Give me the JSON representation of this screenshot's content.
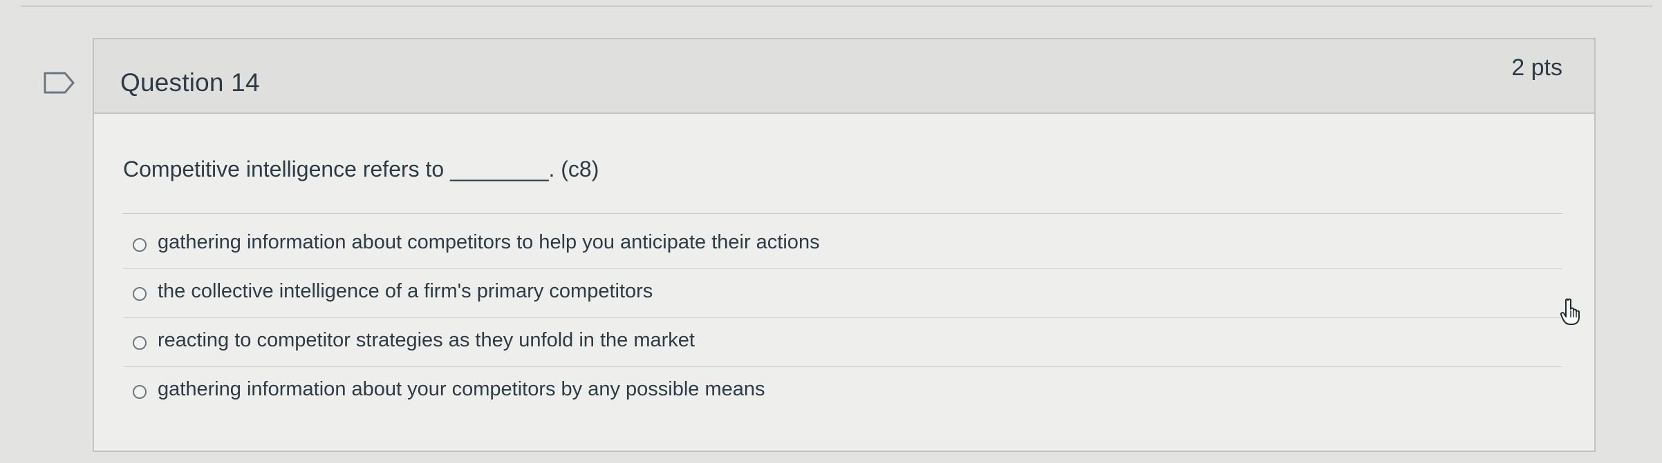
{
  "question": {
    "title": "Question 14",
    "points": "2 pts",
    "text": "Competitive intelligence refers to ________. (c8)",
    "answers": [
      {
        "label": "gathering information about competitors to help you anticipate their actions"
      },
      {
        "label": "the collective intelligence of a firm's primary competitors"
      },
      {
        "label": "reacting to competitor strategies as they unfold in the market"
      },
      {
        "label": "gathering information about your competitors by any possible means"
      }
    ]
  },
  "icons": {
    "flag": "flag-icon",
    "cursor": "hand-pointer-icon"
  }
}
